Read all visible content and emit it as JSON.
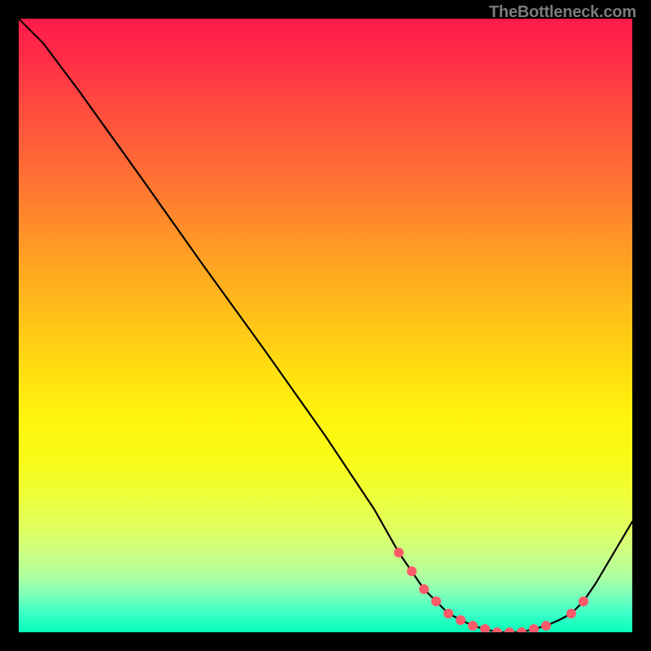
{
  "watermark": "TheBottleneck.com",
  "chart_data": {
    "type": "line",
    "title": "",
    "xlabel": "",
    "ylabel": "",
    "xlim": [
      0,
      100
    ],
    "ylim": [
      0,
      100
    ],
    "x": [
      0,
      4,
      10,
      20,
      30,
      40,
      50,
      58,
      62,
      66,
      70,
      74,
      78,
      82,
      86,
      88,
      90,
      92,
      94,
      100
    ],
    "values": [
      100,
      96,
      88,
      74,
      60,
      46,
      32,
      20,
      13,
      7,
      3,
      1,
      0,
      0,
      1,
      2,
      3,
      5,
      8,
      18
    ],
    "marker_points_x": [
      62,
      64,
      66,
      68,
      70,
      72,
      74,
      76,
      78,
      80,
      82,
      84,
      86,
      90,
      92
    ],
    "marker_points_y": [
      13,
      10,
      7,
      5,
      3,
      2,
      1,
      0.5,
      0,
      0,
      0,
      0.5,
      1,
      3,
      5
    ],
    "curve_color": "#000000",
    "marker_color": "#ff5a6a",
    "gradient_top": "#ff1b4a",
    "gradient_bottom": "#05ffb8"
  }
}
